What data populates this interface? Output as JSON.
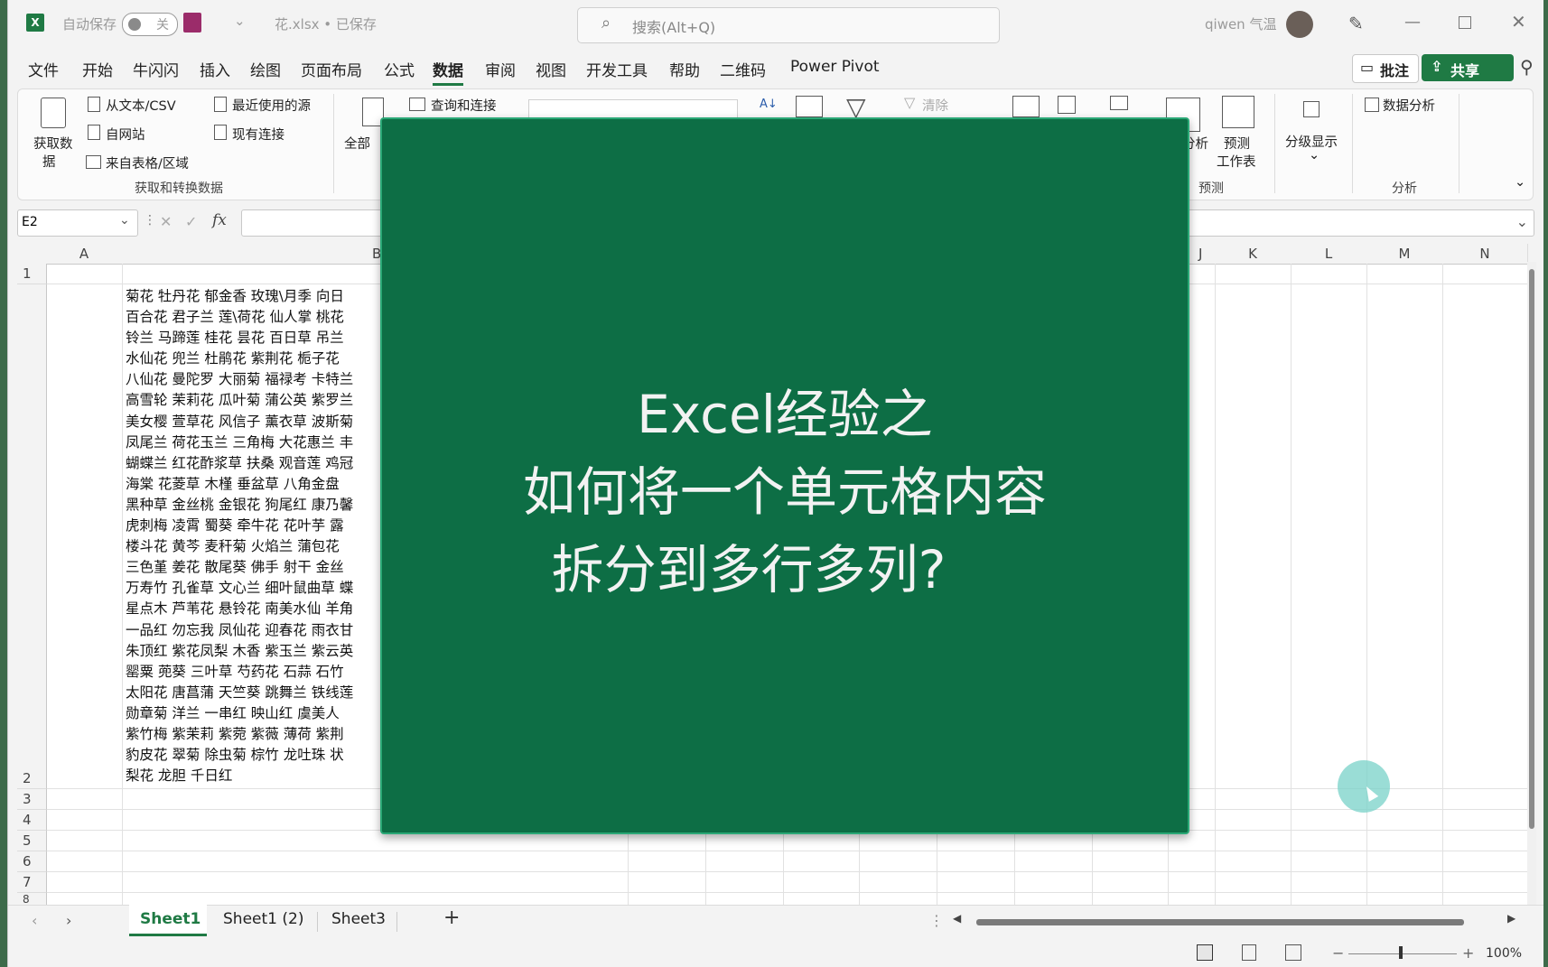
{
  "titlebar": {
    "autosave_label": "自动保存",
    "autosave_state": "关",
    "filename": "花.xlsx • 已保存",
    "search_placeholder": "搜索(Alt+Q)",
    "user": "qiwen 气温"
  },
  "menu": {
    "items": [
      "文件",
      "开始",
      "牛闪闪",
      "插入",
      "绘图",
      "页面布局",
      "公式",
      "数据",
      "审阅",
      "视图",
      "开发工具",
      "帮助",
      "二维码",
      "Power Pivot"
    ],
    "active": "数据",
    "comment_button": "批注",
    "share_button": "共享"
  },
  "ribbon": {
    "get_data": "获取数",
    "get_data_2": "据",
    "from_text_csv": "从文本/CSV",
    "from_web": "自网站",
    "from_table": "来自表格/区域",
    "recent_sources": "最近使用的源",
    "existing_connections": "现有连接",
    "group_get_transform": "获取和转换数据",
    "refresh_all": "全部",
    "queries_connections": "查询和连接",
    "clear": "清除",
    "what_if": "分析",
    "forecast_sheet_1": "预测",
    "forecast_sheet_2": "工作表",
    "group_forecast": "预测",
    "outline": "分级显示",
    "data_analysis": "数据分析",
    "group_analysis": "分析"
  },
  "formula_bar": {
    "name_box": "E2",
    "fx": "fx",
    "formula": ""
  },
  "grid": {
    "columns": [
      "A",
      "B",
      "J",
      "K",
      "L",
      "M",
      "N"
    ],
    "rows": [
      "1",
      "2",
      "3",
      "4",
      "5",
      "6",
      "7",
      "8"
    ],
    "cell_lines": [
      "菊花 牡丹花 郁金香 玫瑰\\月季 向日",
      "百合花 君子兰 莲\\荷花 仙人掌 桃花",
      "铃兰 马蹄莲 桂花 昙花 百日草 吊兰",
      "水仙花 兜兰 杜鹃花 紫荆花 栀子花",
      "八仙花 曼陀罗 大丽菊 福禄考 卡特兰",
      "高雪轮 茉莉花 瓜叶菊 蒲公英 紫罗兰",
      "美女樱 萱草花 风信子 薰衣草 波斯菊",
      "凤尾兰 荷花玉兰 三角梅 大花惠兰 丰",
      "蝴蝶兰 红花酢浆草 扶桑 观音莲 鸡冠",
      "海棠 花菱草 木槿 垂盆草 八角金盘",
      "黑种草 金丝桃 金银花 狗尾红 康乃馨",
      "虎刺梅 凌霄 蜀葵 牵牛花 花叶芋 露",
      "楼斗花 黄芩 麦秆菊 火焰兰 蒲包花",
      "三色堇 姜花 散尾葵 佛手 射干 金丝",
      "万寿竹 孔雀草 文心兰 细叶鼠曲草 蝶",
      "星点木 芦苇花 悬铃花 南美水仙 羊角",
      "一品红 勿忘我 凤仙花 迎春花 雨衣甘",
      "朱顶红 紫花凤梨 木香 紫玉兰 紫云英",
      "罂粟 蔸葵 三叶草 芍药花 石蒜 石竹",
      "太阳花 唐菖蒲 天竺葵 跳舞兰 铁线莲",
      "勋章菊 洋兰 一串红 映山红 虞美人",
      "紫竹梅 紫茉莉 紫菀 紫薇 薄荷 紫荆",
      "豹皮花 翠菊 除虫菊 棕竹 龙吐珠 状",
      "梨花 龙胆 千日红"
    ]
  },
  "sheets": {
    "tabs": [
      "Sheet1",
      "Sheet1 (2)",
      "Sheet3"
    ],
    "active": "Sheet1",
    "add": "+"
  },
  "status": {
    "zoom": "100%"
  },
  "overlay": {
    "line1": "Excel经验之",
    "line2": "如何将一个单元格内容",
    "line3": "拆分到多行多列?"
  },
  "colors": {
    "excel_green": "#1f7a44",
    "overlay_green": "#0d6e45"
  }
}
